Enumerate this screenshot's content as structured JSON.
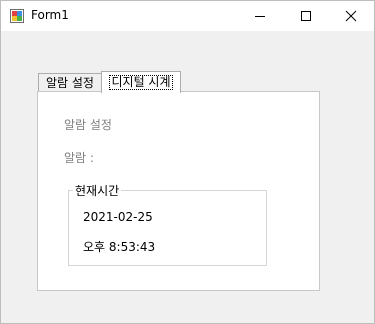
{
  "window": {
    "title": "Form1",
    "icon": "winforms-app-icon",
    "caption_buttons": [
      "minimize-icon",
      "maximize-icon",
      "close-icon"
    ]
  },
  "tabs": [
    {
      "label": "알람 설정",
      "active": false
    },
    {
      "label": "디지털 시계",
      "active": true
    }
  ],
  "page": {
    "alarm_setting_label": "알람 설정",
    "alarm_label": "알람 :",
    "current_time_group": {
      "title": "현재시간",
      "date": "2021-02-25",
      "time": "오후 8:53:43"
    }
  }
}
